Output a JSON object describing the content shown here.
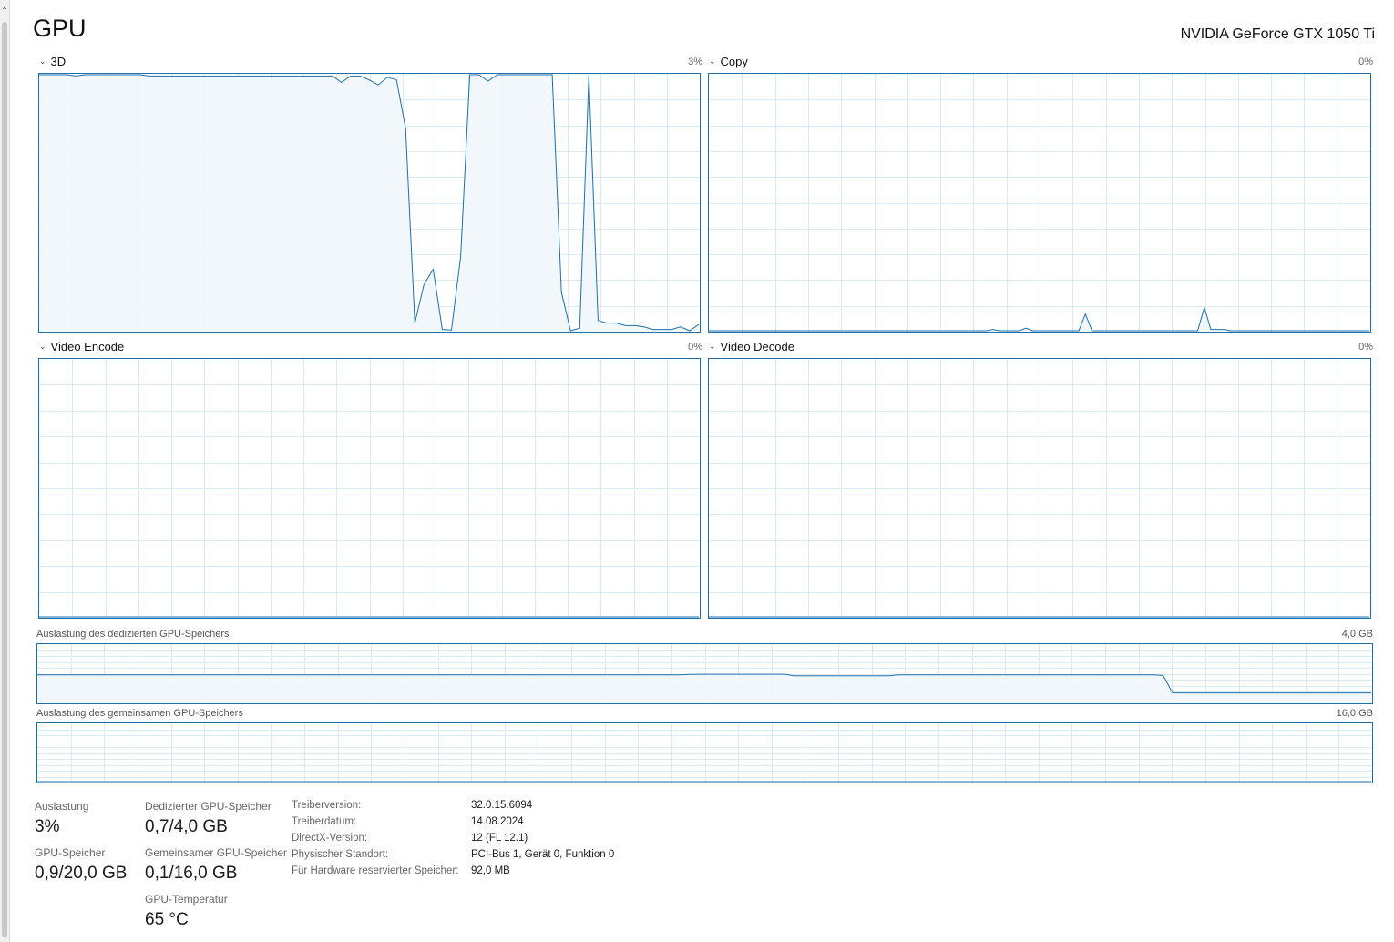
{
  "page_title": "GPU",
  "device_name": "NVIDIA GeForce GTX 1050 Ti",
  "colors": {
    "accent": "#1c70ab",
    "fill": "#f1f6fb",
    "grid": "#d9eaf4"
  },
  "engines": [
    {
      "label": "3D",
      "percent": "3%"
    },
    {
      "label": "Copy",
      "percent": "0%"
    },
    {
      "label": "Video Encode",
      "percent": "0%"
    },
    {
      "label": "Video Decode",
      "percent": "0%"
    }
  ],
  "memory": {
    "dedicated": {
      "label": "Auslastung des dedizierten GPU-Speichers",
      "max": "4,0 GB"
    },
    "shared": {
      "label": "Auslastung des gemeinsamen GPU-Speichers",
      "max": "16,0 GB"
    }
  },
  "stats": {
    "utilization": {
      "label": "Auslastung",
      "value": "3%"
    },
    "dedicated_memory": {
      "label": "Dedizierter GPU-Speicher",
      "value": "0,7/4,0 GB"
    },
    "gpu_memory": {
      "label": "GPU-Speicher",
      "value": "0,9/20,0 GB"
    },
    "shared_memory": {
      "label": "Gemeinsamer GPU-Speicher",
      "value": "0,1/16,0 GB"
    },
    "temperature": {
      "label": "GPU-Temperatur",
      "value": "65 °C"
    }
  },
  "driver_info": [
    {
      "key": "Treiberversion:",
      "value": "32.0.15.6094"
    },
    {
      "key": "Treiberdatum:",
      "value": "14.08.2024"
    },
    {
      "key": "DirectX-Version:",
      "value": "12 (FL 12.1)"
    },
    {
      "key": "Physischer Standort:",
      "value": "PCI-Bus 1, Gerät 0, Funktion 0"
    },
    {
      "key": "Für Hardware reservierter Speicher:",
      "value": "92,0 MB"
    }
  ],
  "chart_data": [
    {
      "type": "area",
      "name": "3D",
      "ylim": [
        0,
        100
      ],
      "values": [
        100,
        100,
        100,
        100,
        99.5,
        100,
        100,
        100,
        100,
        100,
        100,
        100,
        99.5,
        99.5,
        99.5,
        99.5,
        99.5,
        99.5,
        99.5,
        99.5,
        99.5,
        99.5,
        99.5,
        99.5,
        99.5,
        99.5,
        99.5,
        99.5,
        99.5,
        99.5,
        99.5,
        99.5,
        99.5,
        97,
        99.5,
        99.5,
        98,
        96,
        99,
        98,
        79,
        3,
        18,
        24,
        0.5,
        0.3,
        29,
        100,
        100,
        97.5,
        100,
        100,
        100,
        100,
        100,
        100,
        100,
        15,
        0,
        1,
        100,
        4,
        3,
        3,
        2,
        2,
        1.5,
        0.5,
        0.5,
        0.5,
        1.5,
        0,
        2.5
      ]
    },
    {
      "type": "area",
      "name": "Copy",
      "ylim": [
        0,
        100
      ],
      "values": [
        0,
        0,
        0,
        0,
        0,
        0,
        0,
        0,
        0,
        0,
        0,
        0,
        0,
        0,
        0,
        0,
        0,
        0,
        0,
        0,
        0,
        0,
        0,
        0,
        0,
        0,
        0,
        0,
        0,
        0,
        0,
        0,
        0,
        0,
        0,
        0,
        0,
        0,
        0,
        0,
        0,
        0,
        0,
        0.5,
        0,
        0,
        0,
        0,
        1,
        0,
        0,
        0,
        0,
        0,
        0,
        0,
        0,
        6.5,
        0,
        0,
        0,
        0,
        0,
        0,
        0,
        0,
        0,
        0,
        0,
        0,
        0,
        0,
        0,
        0,
        0,
        9,
        0.5,
        0.5,
        0.5,
        0,
        0,
        0,
        0,
        0,
        0,
        0,
        0,
        0,
        0,
        0,
        0,
        0,
        0,
        0,
        0,
        0,
        0,
        0,
        0,
        0,
        0
      ]
    },
    {
      "type": "area",
      "name": "Video Encode",
      "ylim": [
        0,
        100
      ],
      "values": [
        0,
        0
      ]
    },
    {
      "type": "area",
      "name": "Video Decode",
      "ylim": [
        0,
        100
      ],
      "values": [
        0,
        0
      ]
    },
    {
      "type": "area",
      "name": "Auslastung des dedizierten GPU-Speichers",
      "ylim": [
        0,
        4
      ],
      "values": [
        1.92,
        1.92,
        1.92,
        1.92,
        1.92,
        1.92,
        1.92,
        1.92,
        1.92,
        1.92,
        1.92,
        1.92,
        1.92,
        1.92,
        1.92,
        1.92,
        1.92,
        1.92,
        1.92,
        1.92,
        1.92,
        1.92,
        1.92,
        1.92,
        1.92,
        1.92,
        1.92,
        1.92,
        1.92,
        1.92,
        1.92,
        1.92,
        1.92,
        1.92,
        1.92,
        1.92,
        1.92,
        1.92,
        1.92,
        1.92,
        1.92,
        1.92,
        1.92,
        1.92,
        1.92,
        1.92,
        1.92,
        1.92,
        1.92,
        1.92,
        1.92,
        1.92,
        1.92,
        1.92,
        1.92,
        1.92,
        1.92,
        1.92,
        1.92,
        1.92,
        1.92,
        1.92,
        1.92,
        1.92,
        1.92,
        1.92,
        1.92,
        1.92,
        1.92,
        1.95,
        1.96,
        1.96,
        1.96,
        1.96,
        1.96,
        1.96,
        1.96,
        1.96,
        1.96,
        1.96,
        1.86,
        1.86,
        1.86,
        1.86,
        1.86,
        1.86,
        1.86,
        1.86,
        1.86,
        1.86,
        1.86,
        1.92,
        1.92,
        1.92,
        1.92,
        1.92,
        1.92,
        1.92,
        1.92,
        1.92,
        1.92,
        1.92,
        1.92,
        1.92,
        1.92,
        1.92,
        1.92,
        1.92,
        1.92,
        1.92,
        1.92,
        1.92,
        1.92,
        1.92,
        1.92,
        1.92,
        1.92,
        1.92,
        1.92,
        1.88,
        0.66,
        0.66,
        0.66,
        0.66,
        0.66,
        0.66,
        0.66,
        0.66,
        0.66,
        0.66,
        0.66,
        0.66,
        0.66,
        0.66,
        0.66,
        0.66,
        0.66,
        0.66,
        0.66,
        0.66,
        0.66,
        0.66
      ]
    },
    {
      "type": "area",
      "name": "Auslastung des gemeinsamen GPU-Speichers",
      "ylim": [
        0,
        16
      ],
      "values": [
        0,
        0
      ]
    }
  ]
}
